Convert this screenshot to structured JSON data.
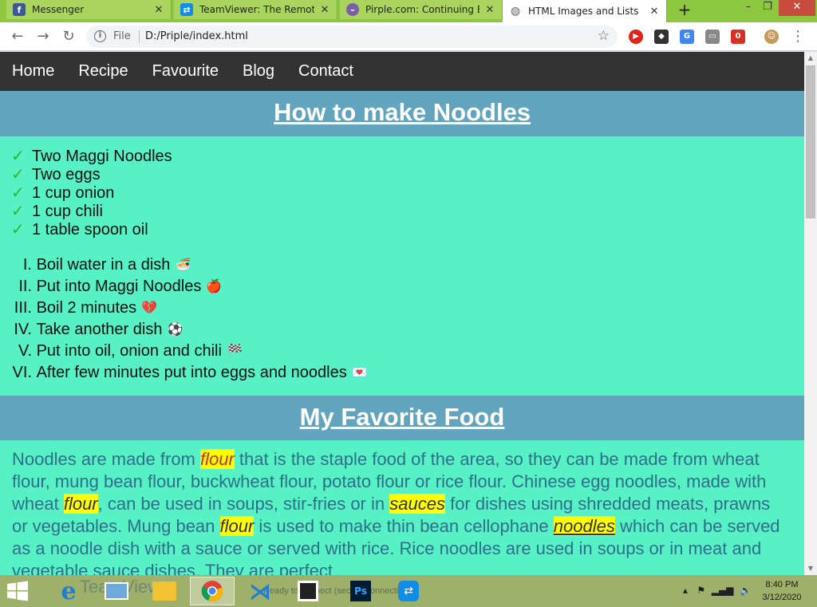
{
  "browser": {
    "tabs": [
      {
        "title": "Messenger",
        "favicon": "facebook-icon",
        "favicon_color": "#3b5998",
        "active": false
      },
      {
        "title": "TeamViewer: The Remote D",
        "favicon": "teamviewer-icon",
        "favicon_color": "#0e8ee9",
        "active": false
      },
      {
        "title": "Pirple.com: Continuing Edu",
        "favicon": "pirple-icon",
        "favicon_color": "#7b5ea7",
        "active": false
      },
      {
        "title": "HTML Images and Lists",
        "favicon": "globe-icon",
        "favicon_color": "#5f6368",
        "active": true
      }
    ],
    "address": {
      "scheme": "File",
      "url": "D:/Priple/index.html"
    }
  },
  "site": {
    "nav": [
      "Home",
      "Recipe",
      "Favourite",
      "Blog",
      "Contact"
    ],
    "heading1": "How to make Noodles",
    "ingredients": [
      "Two Maggi Noodles",
      "Two eggs",
      "1 cup onion",
      "1 cup chili",
      "1 table spoon oil"
    ],
    "steps": [
      {
        "num": "I.",
        "text": "Boil water in a dish",
        "emoji": "🍜"
      },
      {
        "num": "II.",
        "text": "Put into Maggi Noodles",
        "emoji": "🍎"
      },
      {
        "num": "III.",
        "text": "Boil 2 minutes",
        "emoji": "💔"
      },
      {
        "num": "IV.",
        "text": "Take another dish",
        "emoji": "⚽"
      },
      {
        "num": "V.",
        "text": "Put into oil, onion and chili",
        "emoji": "🏁"
      },
      {
        "num": "VI.",
        "text": "After few minutes put into eggs and noodles",
        "emoji": "💌"
      }
    ],
    "heading2": "My Favorite Food",
    "paragraph": {
      "p1": "Noodles are made from ",
      "hl1": "flour",
      "p2": " that is the staple food of the area, so they can be made from wheat flour, mung bean flour, buckwheat flour, potato flour or rice flour. Chinese egg noodles, made with wheat ",
      "hl2": "flour",
      "p3": ", can be used in soups, stir-fries or in ",
      "hl3": "sauces",
      "p4": " for dishes using shredded meats, prawns or vegetables. Mung bean ",
      "hl4": "flour",
      "p5": " is used to make thin bean cellophane ",
      "hl5": "noodles",
      "p6": " which can be served as a noodle dish with a sauce or served with rice. Rice noodles are used in soups or in meat and vegetable sauce dishes. They are perfect"
    }
  },
  "taskbar": {
    "ghost_text": "TeamViewer",
    "ghost_status": "Ready to connect (secure connection)",
    "clock_time": "8:40 PM",
    "clock_date": "3/12/2020"
  },
  "colors": {
    "page_bg": "#56f1c4",
    "band": "#62a3bd",
    "nav_bg": "#333333",
    "highlight": "#ffff00"
  }
}
